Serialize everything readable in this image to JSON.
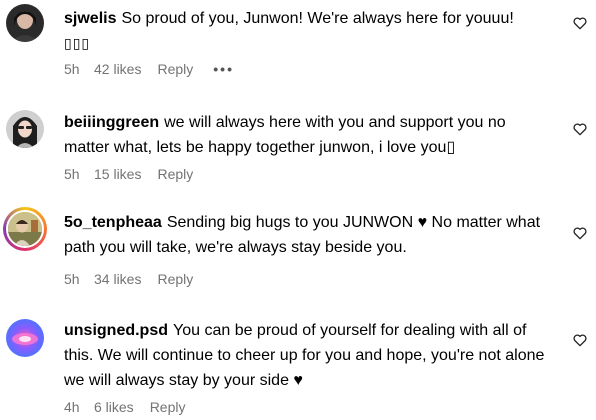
{
  "comments": [
    {
      "username": "sjwelis",
      "text": "So proud of you, Junwon! We're always here for youuu!",
      "text_extra": "▯▯▯",
      "time": "5h",
      "likes": "42 likes",
      "reply": "Reply",
      "more": "•••",
      "avatar_icon": "profile-photo-icon"
    },
    {
      "username": "beiiinggreen",
      "text": "we will always here with you and support you no matter what, lets be happy together junwon, i love you▯",
      "time": "5h",
      "likes": "15 likes",
      "reply": "Reply",
      "avatar_icon": "profile-photo-icon"
    },
    {
      "username": "5o_tenpheaa",
      "text": "Sending big hugs to you JUNWON ♥ No matter what path you will take, we're always stay beside you.",
      "time": "5h",
      "likes": "34 likes",
      "reply": "Reply",
      "avatar_icon": "profile-photo-story-ring-icon"
    },
    {
      "username": "unsigned.psd",
      "text": "You can be proud of yourself for dealing with all of this. We will continue to cheer up for you and hope, you're not alone we will always stay by your side ♥",
      "time": "4h",
      "likes": "6 likes",
      "reply": "Reply",
      "avatar_icon": "profile-photo-icon"
    }
  ],
  "heart_icon": "heart-outline-icon"
}
